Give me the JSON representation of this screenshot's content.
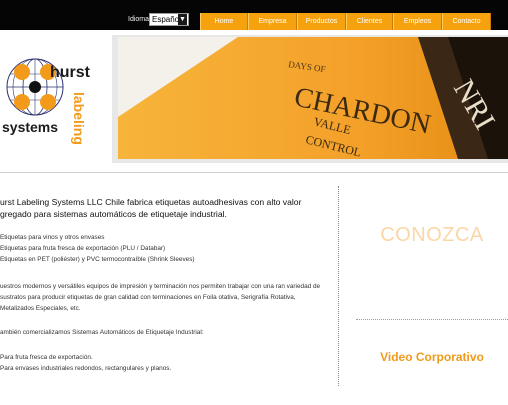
{
  "header": {
    "language_label": "Idioma",
    "language_value": "Español",
    "nav": [
      "Home",
      "Empresa",
      "Productos",
      "Clientes",
      "Empleos",
      "Contacto"
    ]
  },
  "logo": {
    "line1": "hurst",
    "line2": "systems",
    "vertical": "labeling"
  },
  "banner": {
    "text_chardon": "CHARDON",
    "text_vall": "VALLE",
    "text_control": "CONTROL",
    "text_days": "DAYS OF",
    "text_nri": "NRI"
  },
  "content": {
    "intro": "urst Labeling Systems LLC Chile fabrica etiquetas autoadhesivas con alto valor gregado para sistemas automáticos de etiquetaje industrial.",
    "bullets": [
      "Etiquetas para vinos y otros envases",
      "Etiquetas para fruta fresca de exportación (PLU / Databar)",
      "Etiquetas en PET (poliéster) y PVC termocontraíble (Shrink Sleeves)"
    ],
    "paragraph1": "uestros modernos y versátiles equipos de impresión y terminación nos permiten trabajar con una ran variedad de sustratos para producir etiquetas de gran calidad con terminaciones en Foila otativa, Serigrafía Rotativa, Metalizados Especiales, etc.",
    "paragraph2": "ambién comercializamos Sistemas Automáticos de Etiquetaje Industrial:",
    "list2": [
      "Para fruta fresca de exportación.",
      "Para envases industriales redondos, rectangulares y planos."
    ]
  },
  "sidebar": {
    "conozca": "CONOZCA",
    "video": "Video Corporativo"
  },
  "colors": {
    "nav_orange": "#f6a20f",
    "brand_orange": "#f39a1a",
    "logo_blue": "#2a2f6e",
    "conozca": "#fbd6a6"
  }
}
